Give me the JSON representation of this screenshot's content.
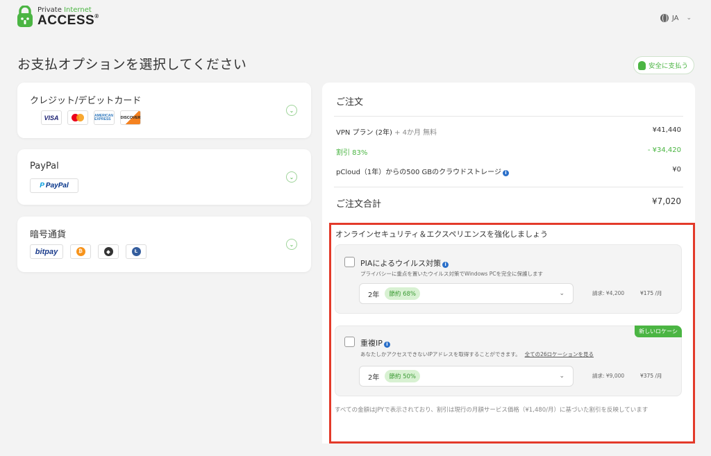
{
  "header": {
    "logo_small_1": "Private",
    "logo_small_2": "Internet",
    "logo_big": "ACCESS",
    "logo_mark": "®",
    "language": "JA",
    "language_chevron": "⌄"
  },
  "page": {
    "title": "お支払オプションを選択してください",
    "secure_badge": "安全に支払う"
  },
  "payment_methods": [
    {
      "label": "クレジット/デビットカード",
      "brands": [
        "VISA",
        "AMERICAN EXPRESS",
        "DISCOVER"
      ]
    },
    {
      "label": "PayPal",
      "brands": [
        "PayPal"
      ]
    },
    {
      "label": "暗号通貨",
      "brands": [
        "bitpay"
      ]
    }
  ],
  "icons": {
    "chevron_down": "⌄",
    "info": "i",
    "bitcoin": "₿",
    "ethereum": "◆",
    "litecoin": "Ł",
    "paypal_p": "P"
  },
  "order": {
    "title": "ご注文",
    "rows": [
      {
        "label": "VPN プラン (2年)",
        "extra": "+ 4か月 無料",
        "amount": "¥41,440"
      },
      {
        "label": "割引 83%",
        "extra": "",
        "amount": "- ¥34,420"
      },
      {
        "label": "pCloud（1年）からの500 GBのクラウドストレージ",
        "extra": "",
        "amount": "¥0"
      }
    ],
    "total_label": "ご注文合計",
    "total_amount": "¥7,020"
  },
  "addons": {
    "heading": "オンラインセキュリティ＆エクスペリエンスを強化しましょう",
    "items": [
      {
        "title": "PIAによるウイルス対策",
        "description": "プライバシーに重点を置いたウイルス対策でWindows PCを完全に保護します",
        "link": "",
        "period": "2年",
        "savings": "節約 68%",
        "billed": "請求: ¥4,200",
        "monthly": "¥175 /月",
        "tag": ""
      },
      {
        "title": "重複IP",
        "description": "あなたしかアクセスできないIPアドレスを取得することができます。",
        "link": "全ての26ロケーションを見る",
        "period": "2年",
        "savings": "節約 50%",
        "billed": "請求: ¥9,000",
        "monthly": "¥375 /月",
        "tag": "新しいロケーシ"
      }
    ],
    "footnote": "すべての金額はJPYで表示されており、割引は現行の月額サービス価格（¥1,480/月）に基づいた割引を反映しています"
  },
  "colors": {
    "accent_green": "#4bb543",
    "highlight_red": "#e33a2a",
    "info_blue": "#2a6fc9"
  }
}
